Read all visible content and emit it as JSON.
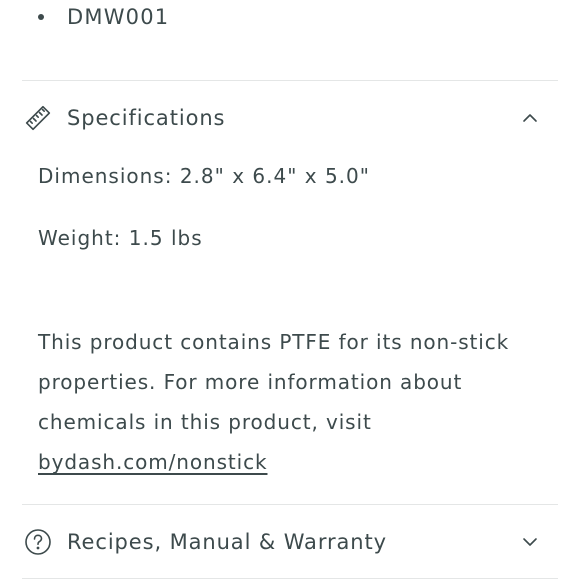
{
  "list": {
    "items": [
      "DMW001"
    ]
  },
  "specifications": {
    "title": "Specifications",
    "icon": "ruler-icon",
    "expanded": true,
    "dimensions": "Dimensions: 2.8\" x 6.4\" x 5.0\"",
    "weight": "Weight: 1.5 lbs",
    "notice_text": "This product contains PTFE for its non-stick properties. For more information about chemicals in this product, visit",
    "notice_link": "bydash.com/nonstick"
  },
  "recipes": {
    "title": "Recipes, Manual & Warranty",
    "icon": "question-circle-icon",
    "expanded": false
  },
  "colors": {
    "text": "#3d4a4c",
    "divider": "#e4e6e6"
  }
}
